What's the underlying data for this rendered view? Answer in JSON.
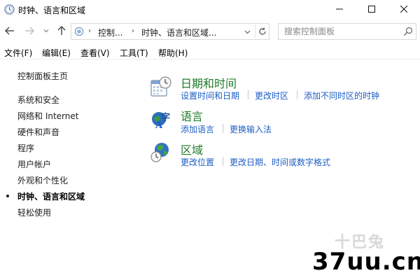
{
  "window": {
    "title": "时钟、语言和区域",
    "controls": {
      "minimize": "—",
      "maximize": "☐",
      "close": "✕"
    }
  },
  "address_bar": {
    "breadcrumbs": [
      "控制...",
      "时钟、语言和区域..."
    ],
    "search_placeholder": "搜索控制面板"
  },
  "menu": {
    "items": [
      "文件(F)",
      "编辑(E)",
      "查看(V)",
      "工具(T)",
      "帮助(H)"
    ]
  },
  "left_nav": {
    "items": [
      "控制面板主页",
      "系统和安全",
      "网络和 Internet",
      "硬件和声音",
      "程序",
      "用户帐户",
      "外观和个性化",
      "时钟、语言和区域",
      "轻松使用"
    ],
    "current_index": 7
  },
  "sections": [
    {
      "title": "日期和时间",
      "icon": "calendar-clock-icon",
      "links": [
        "设置时间和日期",
        "更改时区",
        "添加不同时区的时钟"
      ]
    },
    {
      "title": "语言",
      "icon": "language-icon",
      "links": [
        "添加语言",
        "更换输入法"
      ]
    },
    {
      "title": "区域",
      "icon": "globe-clock-icon",
      "links": [
        "更改位置",
        "更改日期、时间或数字格式"
      ]
    }
  ],
  "watermark": {
    "logo": "十巴兔",
    "site": "37uu.cn"
  },
  "colors": {
    "section_title": "#1f7a2a",
    "link": "#1d5ec4",
    "text": "#1e1e1e"
  }
}
